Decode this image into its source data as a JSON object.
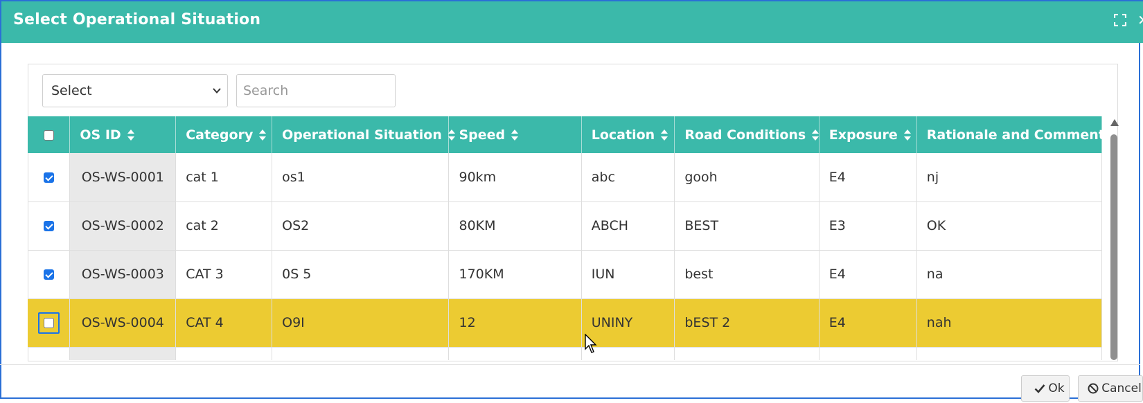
{
  "dialog": {
    "title": "Select Operational Situation",
    "expand_icon": "expand-icon",
    "close_icon": "close-icon"
  },
  "filter": {
    "select_value": "Select",
    "search_placeholder": "Search"
  },
  "table": {
    "columns": [
      "OS ID",
      "Category",
      "Operational Situation",
      "Speed",
      "Location",
      "Road Conditions",
      "Exposure",
      "Rationale and Comments"
    ],
    "rows": [
      {
        "checked": true,
        "os_id": "OS-WS-0001",
        "category": "cat 1",
        "situation": "os1",
        "speed": "90km",
        "location": "abc",
        "road": "gooh",
        "exposure": "E4",
        "rationale": "nj"
      },
      {
        "checked": true,
        "os_id": "OS-WS-0002",
        "category": "cat 2",
        "situation": "OS2",
        "speed": "80KM",
        "location": "ABCH",
        "road": "BEST",
        "exposure": "E3",
        "rationale": "OK"
      },
      {
        "checked": true,
        "os_id": "OS-WS-0003",
        "category": "CAT 3",
        "situation": "0S 5",
        "speed": "170KM",
        "location": "IUN",
        "road": "best",
        "exposure": "E4",
        "rationale": "na"
      },
      {
        "checked": false,
        "highlighted": true,
        "os_id": "OS-WS-0004",
        "category": "CAT 4",
        "situation": "O9I",
        "speed": "12",
        "location": "UNINY",
        "road": "bEST 2",
        "exposure": "E4",
        "rationale": "nah"
      }
    ]
  },
  "footer": {
    "ok_label": "Ok",
    "cancel_label": "Cancel"
  },
  "colors": {
    "header_teal": "#3bb9aa",
    "highlight_row": "#eccb32",
    "checkbox_blue": "#1a73e8"
  }
}
